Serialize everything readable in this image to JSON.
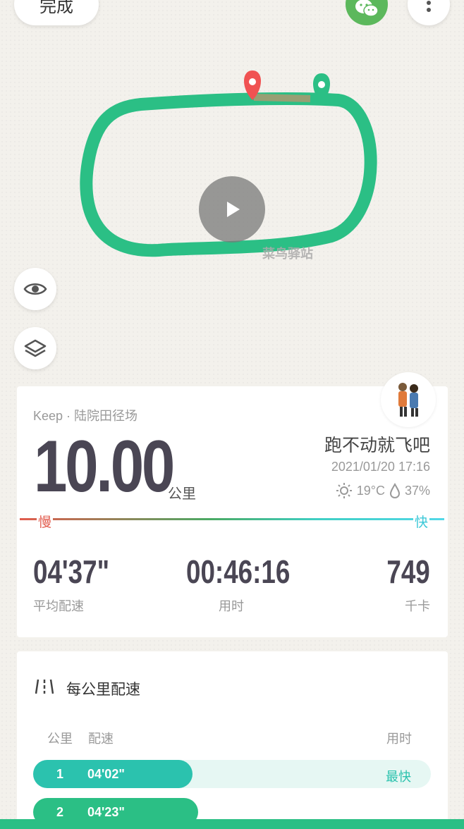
{
  "header": {
    "done_label": "完成",
    "wechat_icon": "wechat-icon",
    "more_icon": "more-vertical-icon"
  },
  "map": {
    "place_label": "菜鸟驿站",
    "route_color": "#2bbf85",
    "start_marker_color": "#2bbf85",
    "end_marker_color": "#f05252"
  },
  "map_controls": {
    "visibility_icon": "eye-icon",
    "layers_icon": "layers-icon",
    "play_icon": "play-icon"
  },
  "summary": {
    "source": "Keep · 陆院田径场",
    "distance": "10.00",
    "distance_unit": "公里",
    "nickname": "跑不动就飞吧",
    "datetime": "2021/01/20 17:16",
    "temperature": "19°C",
    "humidity": "37%",
    "slow_label": "慢",
    "fast_label": "快",
    "stats": [
      {
        "value": "04'37\"",
        "label": "平均配速"
      },
      {
        "value": "00:46:16",
        "label": "用时"
      },
      {
        "value": "749",
        "label": "千卡"
      }
    ]
  },
  "splits": {
    "title": "每公里配速",
    "col_km": "公里",
    "col_pace": "配速",
    "col_time": "用时",
    "rows": [
      {
        "km": "1",
        "pace": "04'02\"",
        "tag": "最快",
        "fill": 0.4
      },
      {
        "km": "2",
        "pace": "04'23\"",
        "tag": "",
        "fill": 0.415
      }
    ]
  }
}
